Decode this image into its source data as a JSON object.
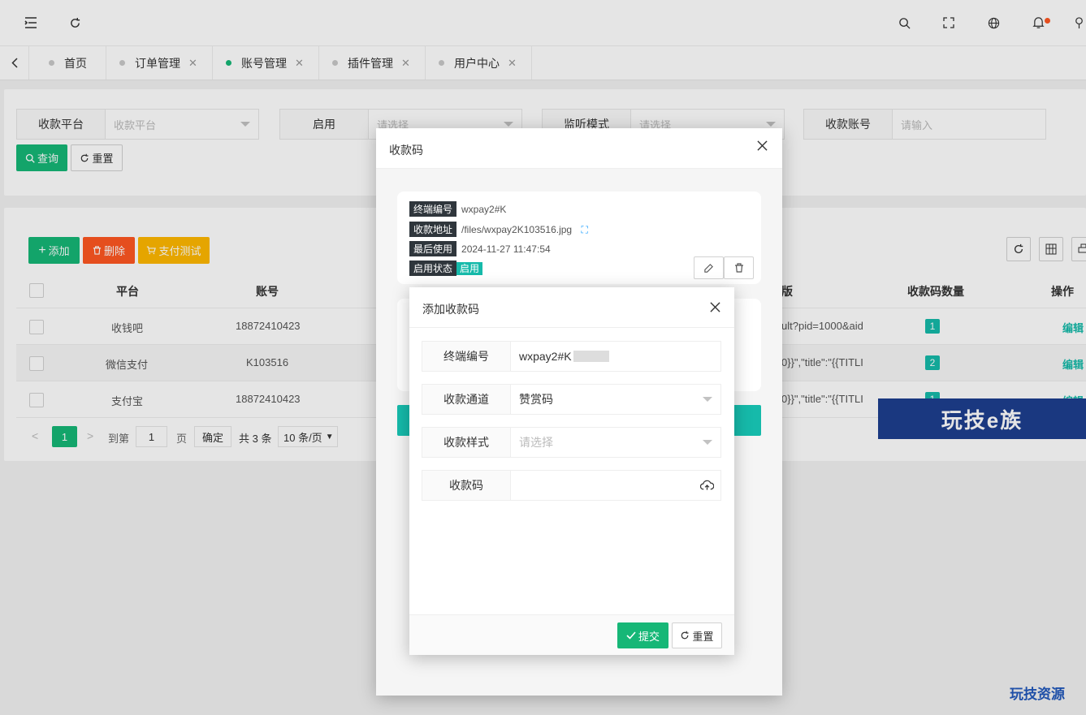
{
  "topbar": {
    "icons": [
      "menu-fold-icon",
      "refresh-icon",
      "search-icon",
      "fullscreen-icon",
      "language-icon",
      "notification-icon",
      "user-icon"
    ]
  },
  "tabs": [
    {
      "label": "首页",
      "closable": false,
      "active": false
    },
    {
      "label": "订单管理",
      "closable": true,
      "active": false
    },
    {
      "label": "账号管理",
      "closable": true,
      "active": true
    },
    {
      "label": "插件管理",
      "closable": true,
      "active": false
    },
    {
      "label": "用户中心",
      "closable": true,
      "active": false
    }
  ],
  "tab_close": "✕",
  "filters": {
    "platform": {
      "label": "收款平台",
      "placeholder": "收款平台"
    },
    "enabled": {
      "label": "启用",
      "placeholder": "请选择"
    },
    "listen_mode": {
      "label": "监听模式",
      "placeholder": "请选择"
    },
    "account": {
      "label": "收款账号",
      "placeholder": "请输入"
    },
    "query_btn": "查询",
    "reset_btn": "重置"
  },
  "toolbar": {
    "add": "添加",
    "delete": "删除",
    "pay_test": "支付测试"
  },
  "table": {
    "headers": {
      "platform": "平台",
      "account": "账号",
      "version": "版",
      "qrcount": "收款码数量",
      "action": "操作"
    },
    "rows": [
      {
        "platform": "收钱吧",
        "account": "18872410423",
        "info": "ult?pid=1000&aid",
        "qrcount": "1",
        "action": "编辑"
      },
      {
        "platform": "微信支付",
        "account": "K103516",
        "info": "0}}\",\"title\":\"{{TITLI",
        "qrcount": "2",
        "action": "编辑"
      },
      {
        "platform": "支付宝",
        "account": "18872410423",
        "info": "0}}\",\"title\":\"{{TITLI",
        "qrcount": "1",
        "action": "编辑"
      }
    ]
  },
  "pagination": {
    "page": "1",
    "goto": "到第",
    "goto_value": "1",
    "page_unit": "页",
    "confirm": "确定",
    "total": "共 3 条",
    "page_size": "10 条/页"
  },
  "qr_dialog": {
    "title": "收款码",
    "item": {
      "terminal_label": "终端编号",
      "terminal_value": "wxpay2#K",
      "addr_label": "收款地址",
      "addr_value": "/files/wxpay2K103516.jpg",
      "last_label": "最后使用",
      "last_value": "2024-11-27 11:47:54",
      "status_label": "启用状态",
      "status_value": "启用"
    }
  },
  "add_dialog": {
    "title": "添加收款码",
    "fields": {
      "terminal": {
        "label": "终端编号",
        "value": "wxpay2#K"
      },
      "channel": {
        "label": "收款通道",
        "value": "赞赏码"
      },
      "style": {
        "label": "收款样式",
        "placeholder": "请选择"
      },
      "qrcode": {
        "label": "收款码"
      }
    },
    "submit": "提交",
    "reset": "重置"
  },
  "watermark": {
    "banner": "玩技e族",
    "corner": "玩技资源"
  },
  "colors": {
    "green": "#16b777",
    "teal": "#16baaa",
    "red": "#ff5722",
    "orange": "#ffb800",
    "dark_tag": "#2f363c"
  }
}
